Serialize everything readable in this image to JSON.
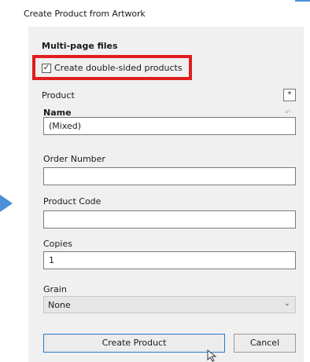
{
  "window": {
    "title": "Create Product from Artwork"
  },
  "section": {
    "heading": "Multi-page files"
  },
  "checkbox": {
    "label": "Create double-sided products",
    "checked": true
  },
  "product": {
    "label": "Product",
    "asterisk_label": "*"
  },
  "fields": {
    "name": {
      "label": "Name",
      "value": "(Mixed)"
    },
    "order_number": {
      "label": "Order Number",
      "value": ""
    },
    "product_code": {
      "label": "Product Code",
      "value": ""
    },
    "copies": {
      "label": "Copies",
      "value": "1"
    }
  },
  "grain": {
    "label": "Grain",
    "selected": "None"
  },
  "buttons": {
    "create_label": "Create Product",
    "cancel_label": "Cancel"
  },
  "colors": {
    "highlight": "#e01e1e",
    "accent": "#2a7cc7",
    "arrow": "#4a90d9"
  },
  "icons": {
    "check": "check-icon",
    "undo": "undo-icon",
    "chevron": "chevron-down-icon",
    "pointer_arrow": "arrow-right-icon",
    "cursor": "mouse-cursor-icon"
  }
}
